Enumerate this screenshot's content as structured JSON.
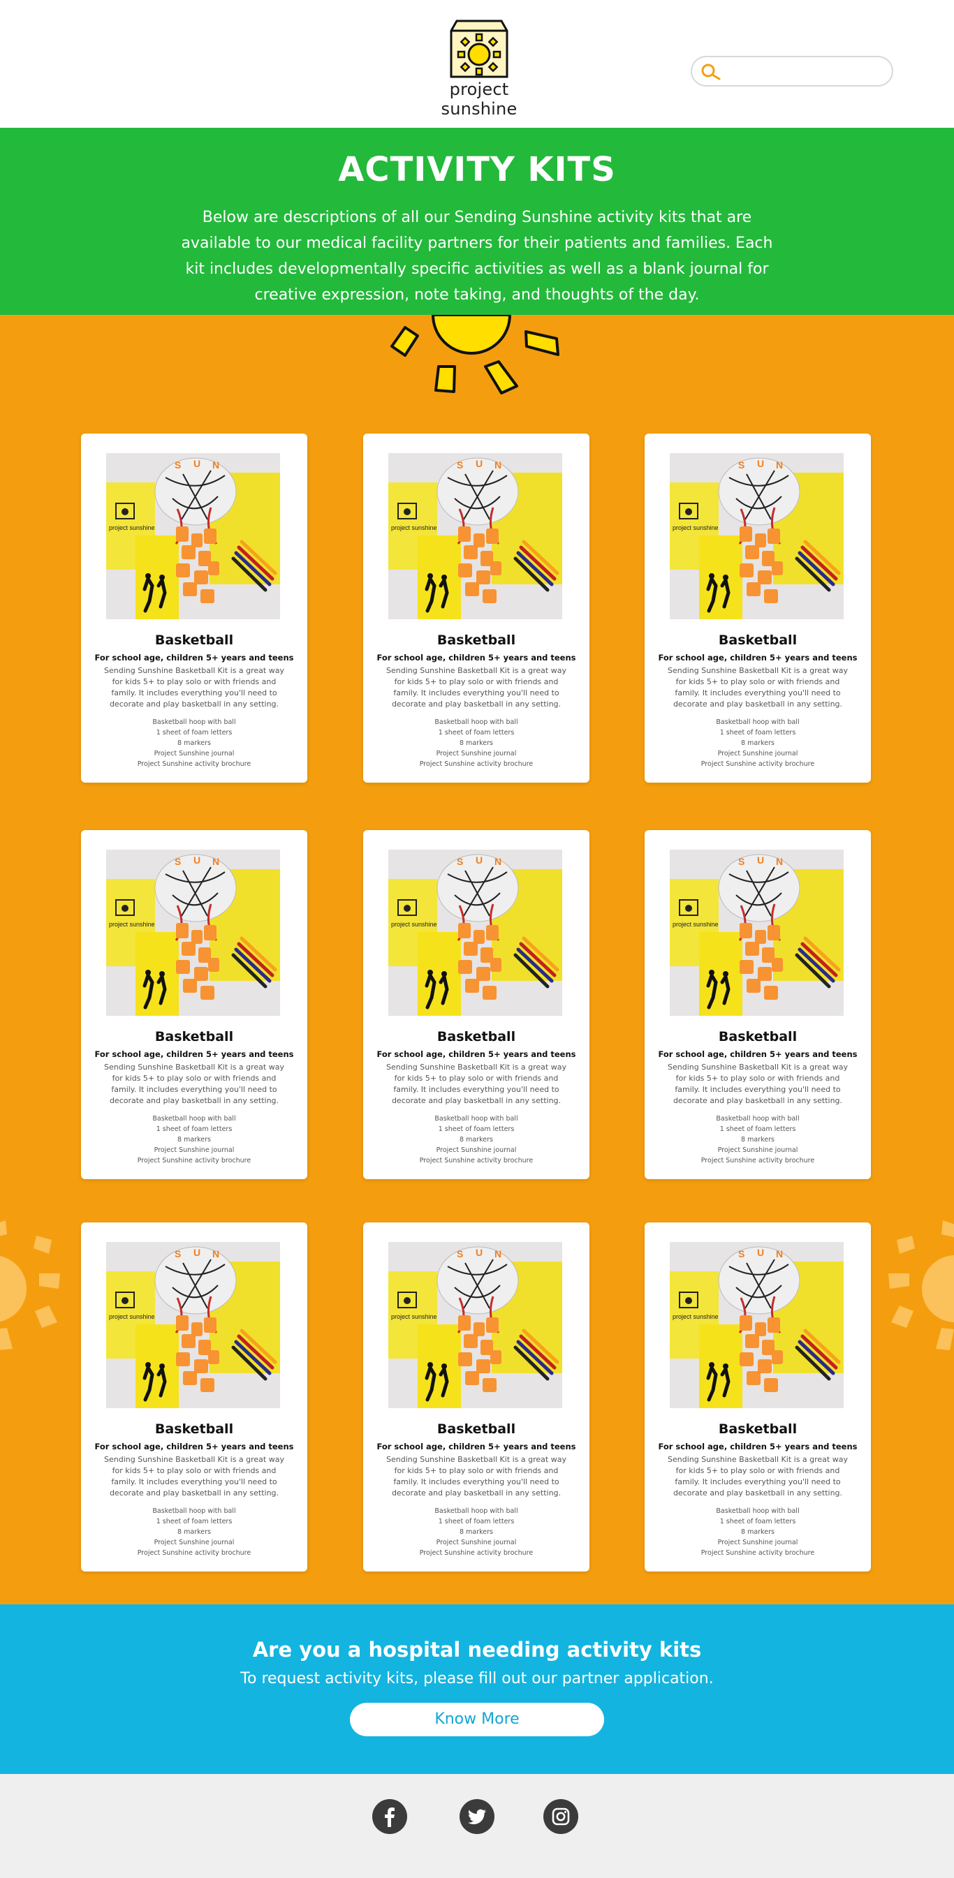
{
  "brand": {
    "name": "project sunshine",
    "logo_icon": "sunshine-box-logo"
  },
  "search": {
    "icon": "search-icon",
    "placeholder": "",
    "value": ""
  },
  "hero": {
    "title": "ACTIVITY KITS",
    "description": "Below are descriptions of all our Sending Sunshine activity kits that are available to our medical facility partners for their patients and families. Each kit includes developmentally specific activities as well as a blank journal for creative expression, note taking, and thoughts of the day."
  },
  "kits": [
    {
      "title": "Basketball",
      "audience": "For school age, children 5+ years and teens",
      "description": "Sending Sunshine Basketball Kit is a great way for kids 5+ to play solo or with friends and family. It includes everything you'll need to decorate and play basketball in any setting.",
      "items": [
        "Basketball hoop with ball",
        "1 sheet of foam letters",
        "8 markers",
        "Project Sunshine journal",
        "Project Sunshine activity brochure"
      ]
    },
    {
      "title": "Basketball",
      "audience": "For school age, children 5+ years and teens",
      "description": "Sending Sunshine Basketball Kit is a great way for kids 5+ to play solo or with friends and family. It includes everything you'll need to decorate and play basketball in any setting.",
      "items": [
        "Basketball hoop with ball",
        "1 sheet of foam letters",
        "8 markers",
        "Project Sunshine journal",
        "Project Sunshine activity brochure"
      ]
    },
    {
      "title": "Basketball",
      "audience": "For school age, children 5+ years and teens",
      "description": "Sending Sunshine Basketball Kit is a great way for kids 5+ to play solo or with friends and family. It includes everything you'll need to decorate and play basketball in any setting.",
      "items": [
        "Basketball hoop with ball",
        "1 sheet of foam letters",
        "8 markers",
        "Project Sunshine journal",
        "Project Sunshine activity brochure"
      ]
    },
    {
      "title": "Basketball",
      "audience": "For school age, children 5+ years and teens",
      "description": "Sending Sunshine Basketball Kit is a great way for kids 5+ to play solo or with friends and family. It includes everything you'll need to decorate and play basketball in any setting.",
      "items": [
        "Basketball hoop with ball",
        "1 sheet of foam letters",
        "8 markers",
        "Project Sunshine journal",
        "Project Sunshine activity brochure"
      ]
    },
    {
      "title": "Basketball",
      "audience": "For school age, children 5+ years and teens",
      "description": "Sending Sunshine Basketball Kit is a great way for kids 5+ to play solo or with friends and family. It includes everything you'll need to decorate and play basketball in any setting.",
      "items": [
        "Basketball hoop with ball",
        "1 sheet of foam letters",
        "8 markers",
        "Project Sunshine journal",
        "Project Sunshine activity brochure"
      ]
    },
    {
      "title": "Basketball",
      "audience": "For school age, children 5+ years and teens",
      "description": "Sending Sunshine Basketball Kit is a great way for kids 5+ to play solo or with friends and family. It includes everything you'll need to decorate and play basketball in any setting.",
      "items": [
        "Basketball hoop with ball",
        "1 sheet of foam letters",
        "8 markers",
        "Project Sunshine journal",
        "Project Sunshine activity brochure"
      ]
    },
    {
      "title": "Basketball",
      "audience": "For school age, children 5+ years and teens",
      "description": "Sending Sunshine Basketball Kit is a great way for kids 5+ to play solo or with friends and family. It includes everything you'll need to decorate and play basketball in any setting.",
      "items": [
        "Basketball hoop with ball",
        "1 sheet of foam letters",
        "8 markers",
        "Project Sunshine journal",
        "Project Sunshine activity brochure"
      ]
    },
    {
      "title": "Basketball",
      "audience": "For school age, children 5+ years and teens",
      "description": "Sending Sunshine Basketball Kit is a great way for kids 5+ to play solo or with friends and family. It includes everything you'll need to decorate and play basketball in any setting.",
      "items": [
        "Basketball hoop with ball",
        "1 sheet of foam letters",
        "8 markers",
        "Project Sunshine journal",
        "Project Sunshine activity brochure"
      ]
    },
    {
      "title": "Basketball",
      "audience": "For school age, children 5+ years and teens",
      "description": "Sending Sunshine Basketball Kit is a great way for kids 5+ to play solo or with friends and family. It includes everything you'll need to decorate and play basketball in any setting.",
      "items": [
        "Basketball hoop with ball",
        "1 sheet of foam letters",
        "8 markers",
        "Project Sunshine journal",
        "Project Sunshine activity brochure"
      ]
    }
  ],
  "cta": {
    "title": "Are you a hospital needing activity kits",
    "subtitle": "To request activity kits, please fill out our partner application.",
    "button_label": "Know More"
  },
  "footer": {
    "social": [
      {
        "icon": "facebook-icon"
      },
      {
        "icon": "twitter-icon"
      },
      {
        "icon": "instagram-icon"
      }
    ]
  },
  "colors": {
    "hero_green": "#23b93b",
    "main_orange": "#f49e0f",
    "cta_blue": "#13b4e0",
    "footer_gray": "#efefef",
    "sun_yellow": "#ffde00"
  }
}
